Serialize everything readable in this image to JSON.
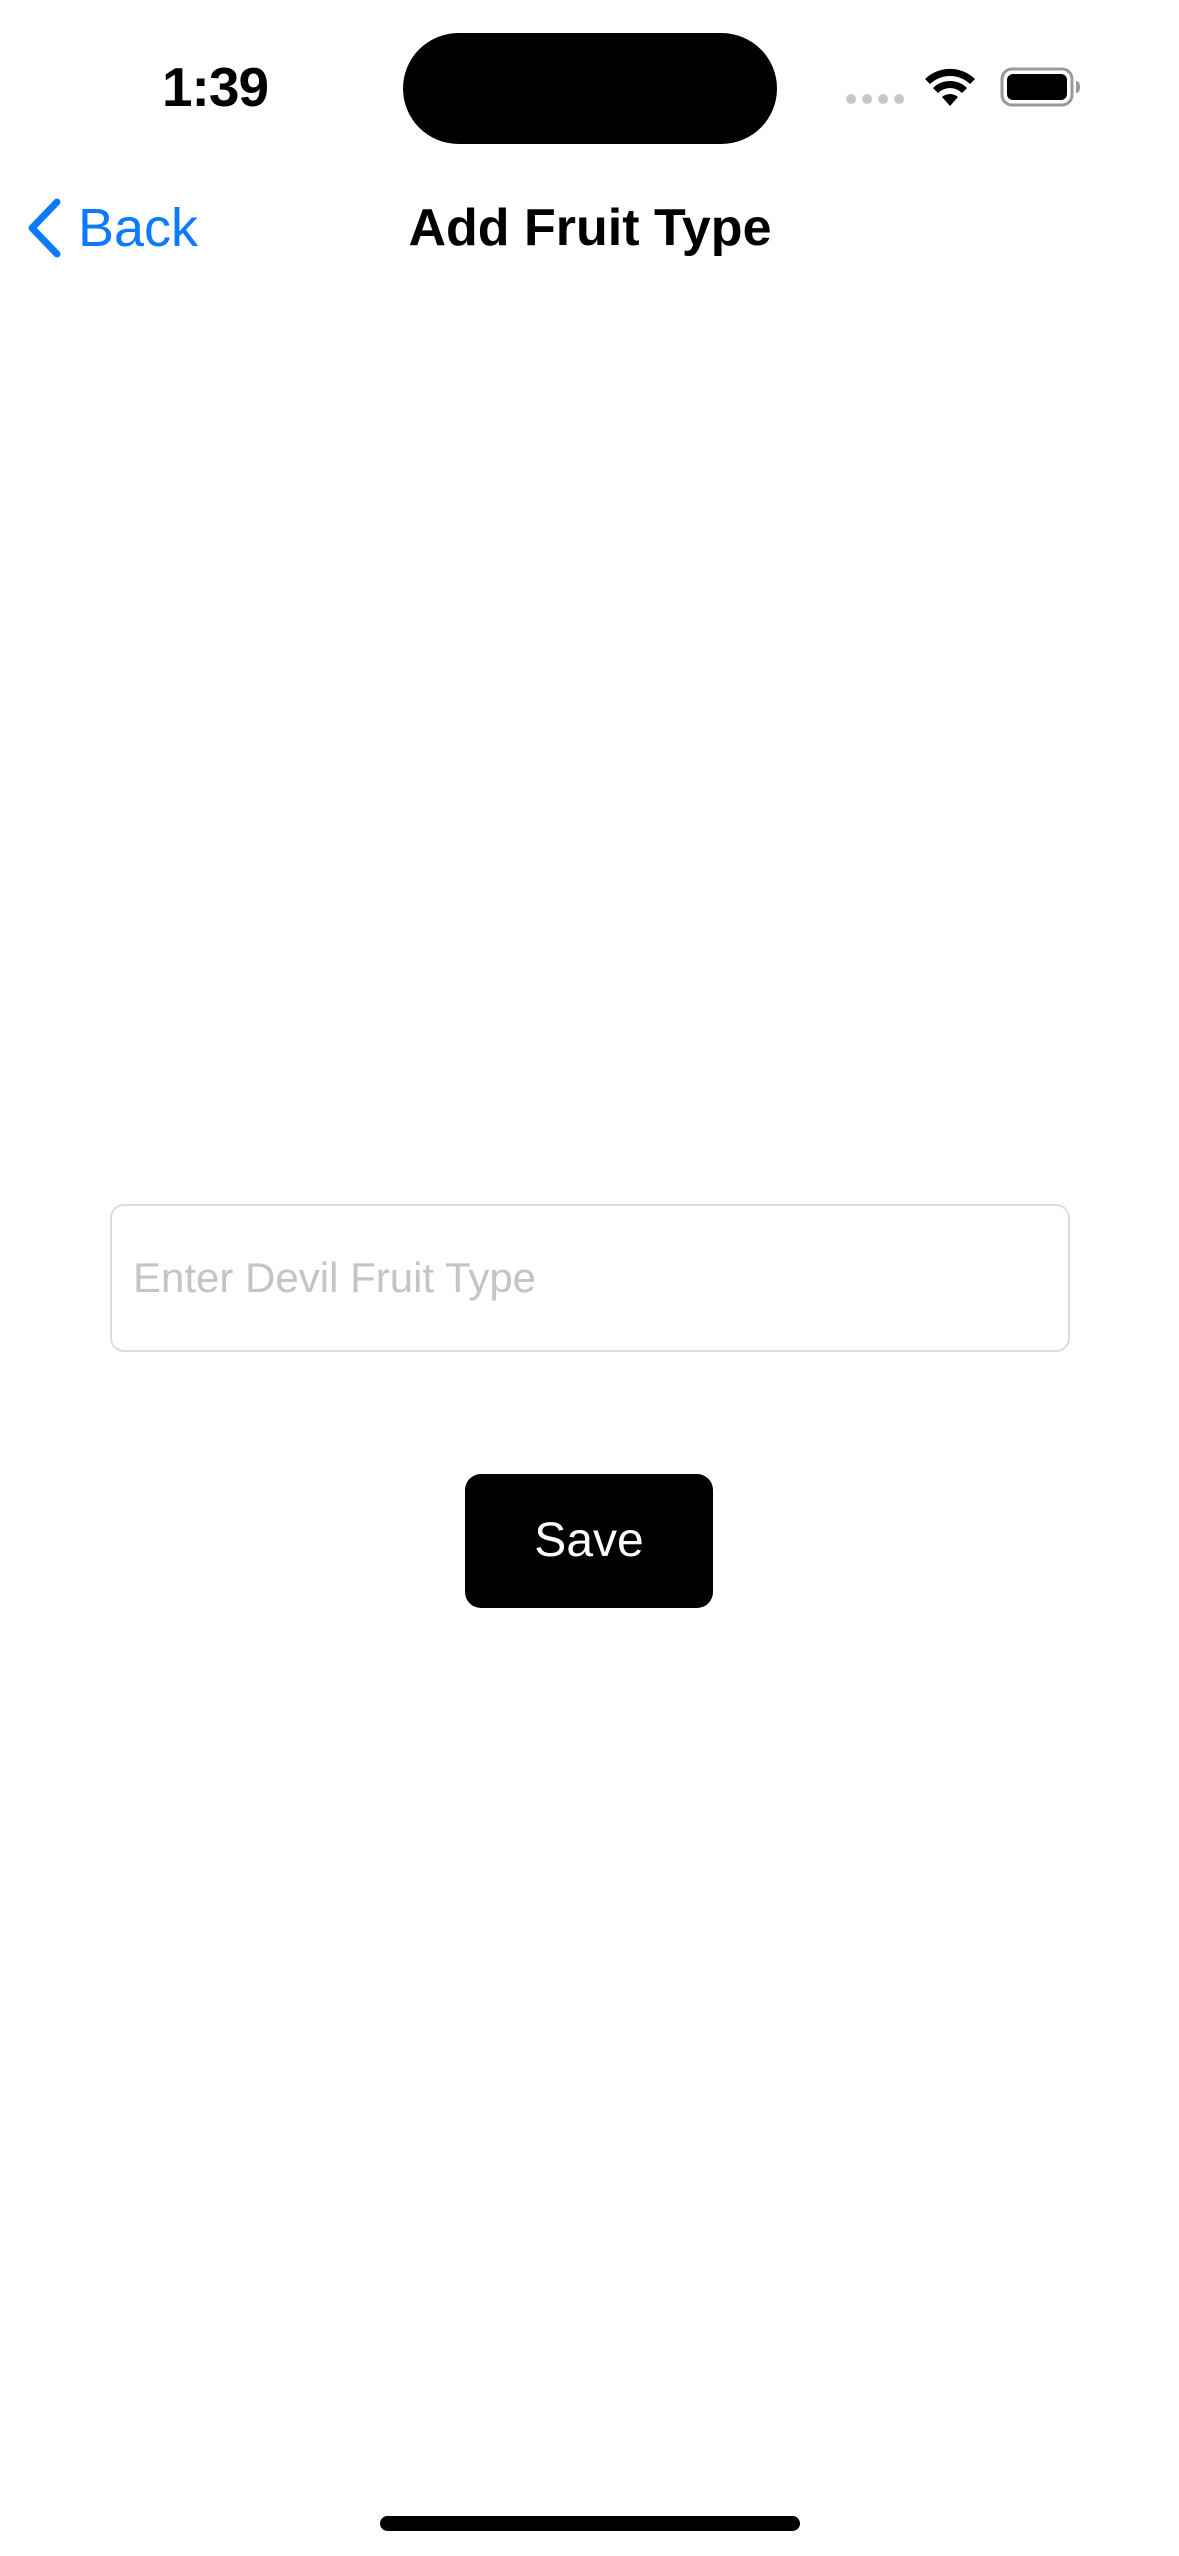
{
  "status_bar": {
    "time": "1:39",
    "icons": [
      "cellular-signal-icon",
      "wifi-icon",
      "battery-icon"
    ]
  },
  "nav": {
    "back_label": "Back",
    "back_icon": "chevron-left-icon",
    "title": "Add Fruit Type",
    "accent_color": "#0a7aff"
  },
  "form": {
    "fruit_type_input": {
      "value": "",
      "placeholder": "Enter Devil Fruit Type"
    },
    "save_label": "Save"
  }
}
